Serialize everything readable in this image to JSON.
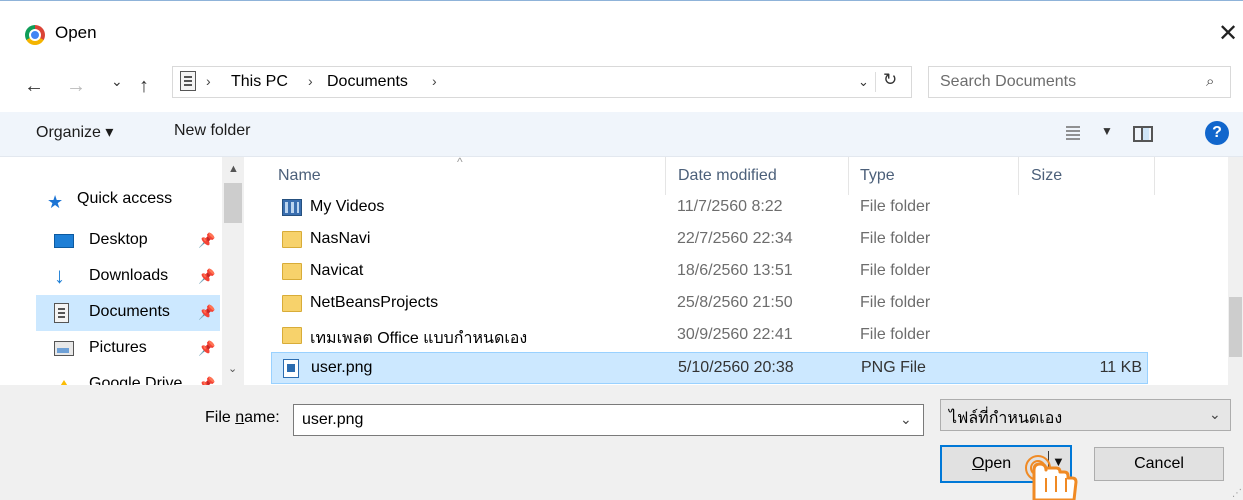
{
  "window": {
    "title": "Open",
    "close_glyph": "✕",
    "app_icon": "chrome-icon"
  },
  "address": {
    "back": "←",
    "forward": "→",
    "recent": "⌄",
    "up": "↑",
    "crumbs": [
      "This PC",
      "Documents"
    ],
    "separator": "›",
    "dropdown": "⌄",
    "refresh": "↻"
  },
  "search": {
    "placeholder": "Search Documents",
    "icon": "⌕"
  },
  "toolbar": {
    "organize": "Organize ▾",
    "new_folder": "New folder",
    "view_dd": "▼",
    "help": "?"
  },
  "nav": {
    "quick_access": "Quick access",
    "items": [
      {
        "label": "Desktop",
        "icon": "desktop-icon",
        "pin": "📌"
      },
      {
        "label": "Downloads",
        "icon": "downloads-icon",
        "pin": "📌"
      },
      {
        "label": "Documents",
        "icon": "documents-icon",
        "pin": "📌",
        "selected": true
      },
      {
        "label": "Pictures",
        "icon": "pictures-icon",
        "pin": "📌"
      },
      {
        "label": "Google Drive",
        "icon": "google-drive-icon",
        "pin": "📌"
      }
    ],
    "scroll_up": "▲",
    "scroll_down": "⌄"
  },
  "columns": {
    "name": "Name",
    "date": "Date modified",
    "type": "Type",
    "size": "Size",
    "sort_caret": "^"
  },
  "files": [
    {
      "name": "My Videos",
      "date": "11/7/2560 8:22",
      "type": "File folder",
      "size": "",
      "icon": "video-folder-icon"
    },
    {
      "name": "NasNavi",
      "date": "22/7/2560 22:34",
      "type": "File folder",
      "size": "",
      "icon": "folder-icon"
    },
    {
      "name": "Navicat",
      "date": "18/6/2560 13:51",
      "type": "File folder",
      "size": "",
      "icon": "folder-icon"
    },
    {
      "name": "NetBeansProjects",
      "date": "25/8/2560 21:50",
      "type": "File folder",
      "size": "",
      "icon": "folder-icon"
    },
    {
      "name": "เทมเพลต Office แบบกำหนดเอง",
      "date": "30/9/2560 22:41",
      "type": "File folder",
      "size": "",
      "icon": "folder-icon"
    },
    {
      "name": "user.png",
      "date": "5/10/2560 20:38",
      "type": "PNG File",
      "size": "11 KB",
      "icon": "png-file-icon",
      "selected": true
    }
  ],
  "bottom": {
    "file_name_prefix": "File ",
    "file_name_underlined": "n",
    "file_name_suffix": "ame:",
    "file_name_value": "user.png",
    "file_name_dd": "⌄",
    "filter_value": "ไฟล์ที่กำหนดเอง",
    "filter_dd": "⌄",
    "open_underlined": "O",
    "open_rest": "pen",
    "open_dd": "▼",
    "cancel": "Cancel"
  },
  "colors": {
    "accent": "#0078d7",
    "selection": "#cce8ff",
    "toolbar_bg": "#f0f5fb",
    "help_blue": "#1166cc",
    "hand_orange": "#f08a24"
  }
}
